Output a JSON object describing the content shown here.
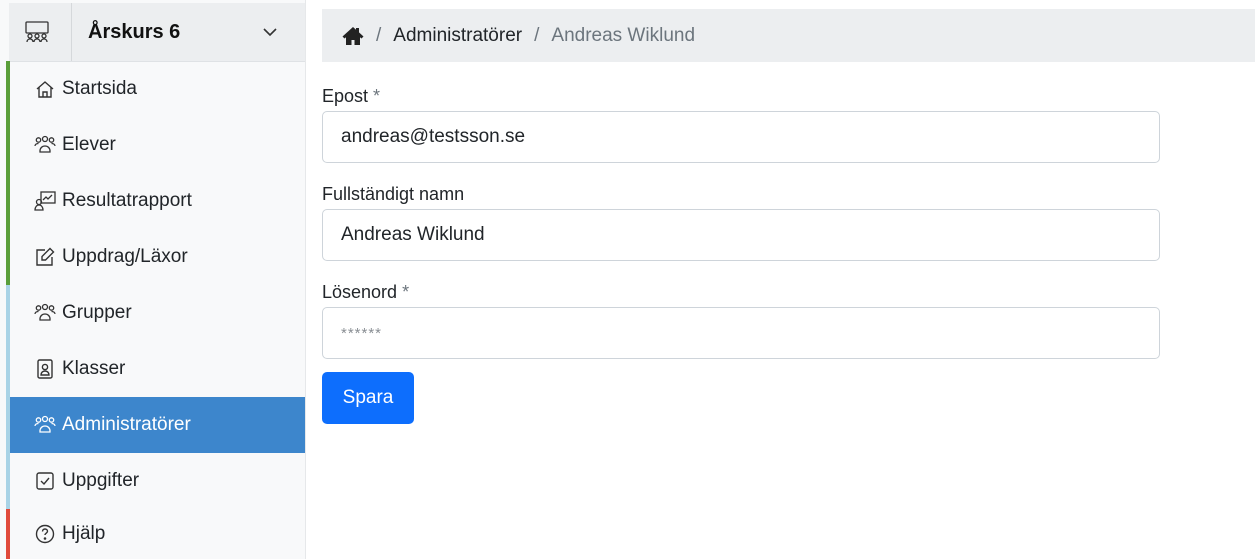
{
  "sidebar": {
    "course": {
      "title": "Årskurs 6",
      "icon": "group-icon",
      "dropdown_icon": "chevron-down-icon"
    },
    "items": [
      {
        "label": "Startsida",
        "icon": "home-icon",
        "active": false
      },
      {
        "label": "Elever",
        "icon": "people-icon",
        "active": false
      },
      {
        "label": "Resultatrapport",
        "icon": "report-icon",
        "active": false
      },
      {
        "label": "Uppdrag/Läxor",
        "icon": "edit-icon",
        "active": false
      },
      {
        "label": "Grupper",
        "icon": "people-icon",
        "active": false
      },
      {
        "label": "Klasser",
        "icon": "person-badge-icon",
        "active": false
      },
      {
        "label": "Administratörer",
        "icon": "people-icon",
        "active": true
      },
      {
        "label": "Uppgifter",
        "icon": "checkbox-icon",
        "active": false
      },
      {
        "label": "Hjälp",
        "icon": "question-circle-icon",
        "active": false
      }
    ],
    "accent_colors": {
      "green": "#5a9e3a",
      "light_blue": "#a9d3e6",
      "red": "#e04a3b"
    }
  },
  "breadcrumb": {
    "home_icon": "home-icon",
    "separator": "/",
    "link": "Administratörer",
    "current": "Andreas Wiklund"
  },
  "form": {
    "email": {
      "label": "Epost",
      "required_mark": "*",
      "value": "andreas@testsson.se"
    },
    "fullname": {
      "label": "Fullständigt namn",
      "value": "Andreas Wiklund"
    },
    "password": {
      "label": "Lösenord",
      "required_mark": "*",
      "value": "******"
    },
    "submit_label": "Spara"
  },
  "colors": {
    "primary": "#0d6efd",
    "active_nav": "#3d86cc"
  }
}
